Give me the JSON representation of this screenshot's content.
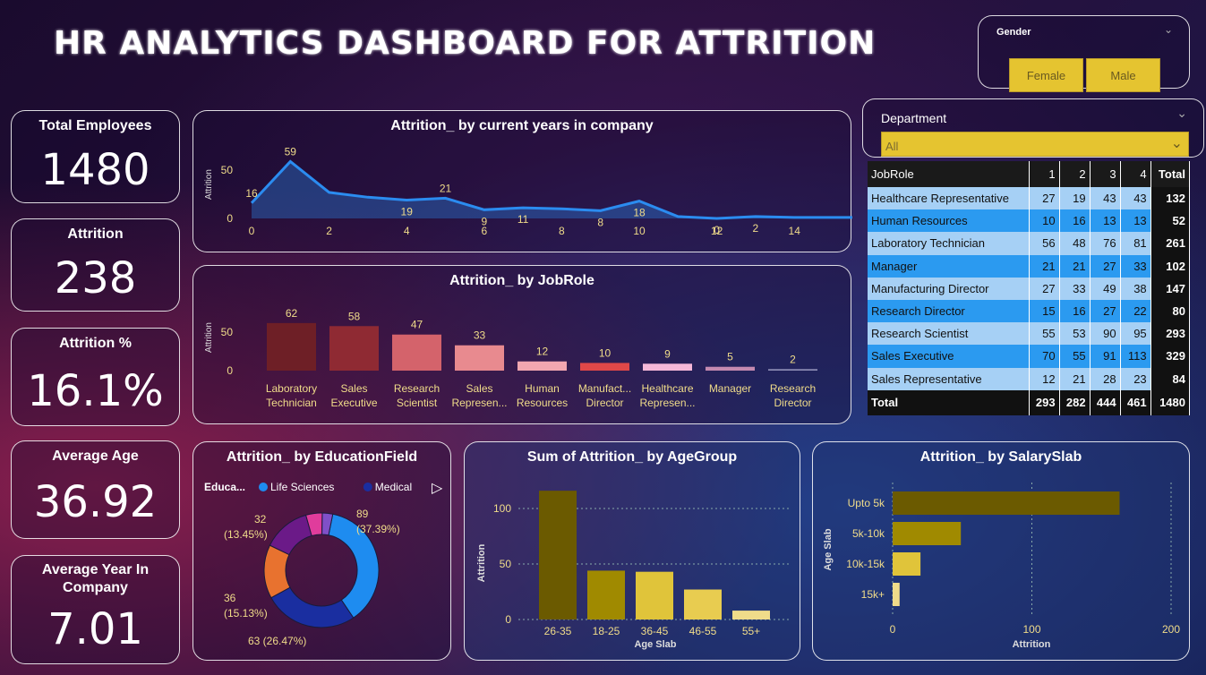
{
  "title": "HR ANALYTICS DASHBOARD FOR ATTRITION",
  "kpis": [
    {
      "label": "Total Employees",
      "value": "1480"
    },
    {
      "label": "Attrition",
      "value": "238"
    },
    {
      "label": "Attrition %",
      "value": "16.1%"
    },
    {
      "label": "Average Age",
      "value": "36.92"
    },
    {
      "label": "Average Year In Company",
      "value": "7.01"
    }
  ],
  "gender": {
    "label": "Gender",
    "options": [
      "Female",
      "Male"
    ]
  },
  "department": {
    "label": "Department",
    "value": "All"
  },
  "jobrole_table": {
    "headers": [
      "JobRole",
      "1",
      "2",
      "3",
      "4",
      "Total"
    ],
    "rows": [
      [
        "Healthcare Representative",
        "27",
        "19",
        "43",
        "43",
        "132"
      ],
      [
        "Human Resources",
        "10",
        "16",
        "13",
        "13",
        "52"
      ],
      [
        "Laboratory Technician",
        "56",
        "48",
        "76",
        "81",
        "261"
      ],
      [
        "Manager",
        "21",
        "21",
        "27",
        "33",
        "102"
      ],
      [
        "Manufacturing Director",
        "27",
        "33",
        "49",
        "38",
        "147"
      ],
      [
        "Research Director",
        "15",
        "16",
        "27",
        "22",
        "80"
      ],
      [
        "Research Scientist",
        "55",
        "53",
        "90",
        "95",
        "293"
      ],
      [
        "Sales Executive",
        "70",
        "55",
        "91",
        "113",
        "329"
      ],
      [
        "Sales Representative",
        "12",
        "21",
        "28",
        "23",
        "84"
      ]
    ],
    "total": [
      "Total",
      "293",
      "282",
      "444",
      "461",
      "1480"
    ]
  },
  "colors": {
    "accent": "#e5c430",
    "line": "#2b8cf0",
    "bar_dark": "#7a1f2a"
  },
  "chart_data": [
    {
      "id": "years",
      "type": "area",
      "title": "Attrition_ by current years in company",
      "ylabel": "Attrition",
      "x": [
        0,
        1,
        2,
        3,
        4,
        5,
        6,
        7,
        8,
        9,
        10,
        11,
        12,
        13,
        14,
        15,
        16,
        17,
        18
      ],
      "values": [
        16,
        59,
        27,
        22,
        19,
        21,
        9,
        11,
        10,
        8,
        18,
        2,
        0,
        2,
        1,
        1,
        1,
        1,
        0
      ],
      "labels": {
        "0": "16",
        "1": "59",
        "4": "19",
        "5": "21",
        "6": "9",
        "7": "11",
        "9": "8",
        "10": "18",
        "12": "0",
        "13": "2"
      },
      "xticks": [
        "0",
        "2",
        "4",
        "6",
        "8",
        "10",
        "12",
        "14"
      ],
      "yticks": [
        "0",
        "50"
      ],
      "ylim": [
        0,
        65
      ]
    },
    {
      "id": "jobrole",
      "type": "bar",
      "title": "Attrition_ by JobRole",
      "ylabel": "Attrition",
      "categories": [
        [
          "Laboratory",
          "Technician"
        ],
        [
          "Sales",
          "Executive"
        ],
        [
          "Research",
          "Scientist"
        ],
        [
          "Sales",
          "Represen..."
        ],
        [
          "Human",
          "Resources"
        ],
        [
          "Manufact...",
          "Director"
        ],
        [
          "Healthcare",
          "Represen..."
        ],
        [
          "Manager"
        ],
        [
          "Research",
          "Director"
        ]
      ],
      "values": [
        62,
        58,
        47,
        33,
        12,
        10,
        9,
        5,
        2
      ],
      "colors": [
        "#6e1f26",
        "#8f2a33",
        "#d4636b",
        "#e88a8f",
        "#f2a7b0",
        "#e04848",
        "#f5b8d8",
        "#c48ab0",
        "#8c8cb4"
      ],
      "yticks": [
        "0",
        "50"
      ],
      "ylim": [
        0,
        70
      ]
    },
    {
      "id": "education",
      "type": "pie",
      "title": "Attrition_ by EducationField",
      "legend_title": "Educa...",
      "legend": [
        {
          "name": "Life Sciences",
          "color": "#1e8cf0"
        },
        {
          "name": "Medical",
          "color": "#1a2ea0"
        }
      ],
      "slices": [
        {
          "value": 89,
          "color": "#1e8cf0",
          "label": "89",
          "pct": "(37.39%)"
        },
        {
          "value": 63,
          "color": "#1a2ea0",
          "label": "63 (26.47%)",
          "pct": ""
        },
        {
          "value": 36,
          "color": "#e8722f",
          "label": "36",
          "pct": "(15.13%)"
        },
        {
          "value": 32,
          "color": "#6b1a88",
          "label": "32",
          "pct": "(13.45%)"
        },
        {
          "value": 11,
          "color": "#e03c9c",
          "label": "",
          "pct": ""
        },
        {
          "value": 7,
          "color": "#8050c8",
          "label": "",
          "pct": ""
        }
      ]
    },
    {
      "id": "agegroup",
      "type": "bar",
      "title": "Sum of Attrition_ by AgeGroup",
      "xlabel": "Age Slab",
      "ylabel": "Attrition",
      "categories": [
        "26-35",
        "18-25",
        "36-45",
        "46-55",
        "55+"
      ],
      "values": [
        116,
        44,
        43,
        27,
        8
      ],
      "colors": [
        "#6b5a00",
        "#a08a00",
        "#e0c43a",
        "#e8cc50",
        "#f0dc8a"
      ],
      "yticks": [
        "0",
        "50",
        "100"
      ],
      "ylim": [
        0,
        125
      ]
    },
    {
      "id": "salary",
      "type": "bar",
      "orientation": "horizontal",
      "title": "Attrition_ by SalarySlab",
      "xlabel": "Attrition",
      "ylabel": "Age Slab",
      "categories": [
        "Upto 5k",
        "5k-10k",
        "10k-15k",
        "15k+"
      ],
      "values": [
        163,
        49,
        20,
        5
      ],
      "colors": [
        "#6b5a00",
        "#a08a00",
        "#e0c43a",
        "#f0dc8a"
      ],
      "xticks": [
        "0",
        "100",
        "200"
      ],
      "xlim": [
        0,
        200
      ]
    }
  ]
}
